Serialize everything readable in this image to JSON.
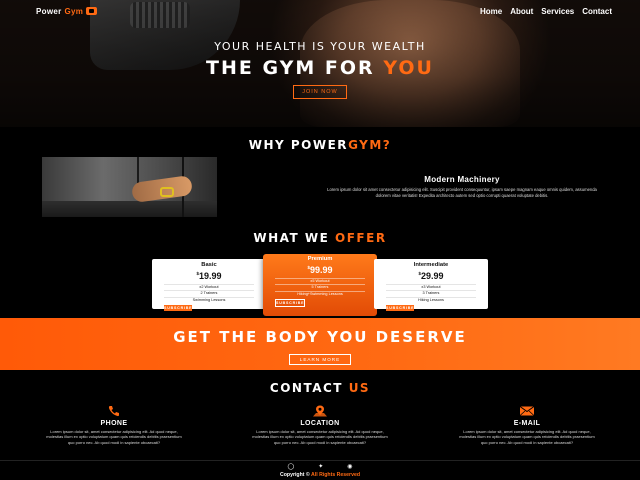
{
  "nav": {
    "logo_text": "Power",
    "logo_accent": "Gym",
    "links": [
      "Home",
      "About",
      "Services",
      "Contact"
    ]
  },
  "hero": {
    "subtitle": "YOUR HEALTH IS YOUR WEALTH",
    "title_main": "THE GYM FOR",
    "title_accent": "YOU",
    "button_label": "JOIN NOW"
  },
  "why": {
    "title_main": "WHY POWER",
    "title_accent": "GYM?",
    "feature_heading": "Modern Machinery",
    "feature_text": "Lorem ipsum dolor sit amet consectetur adipisicing elit. Suscipit provident consequuntur, ipsam saepe magnam eaque omnis quidem, assumenda dolorem vitae veritatis! Expedita architecto autem sed optio corrupti quaerat voluptate debitis."
  },
  "offer": {
    "title_main": "WHAT WE",
    "title_accent": "OFFER",
    "plans": [
      {
        "name": "Basic",
        "currency": "$",
        "price": "19.99",
        "features": [
          "x2 Workout",
          "2 Trainers",
          "Swimming Lessons"
        ],
        "button": "SUBSCRIBE"
      },
      {
        "name": "Premium",
        "currency": "$",
        "price": "99.99",
        "features": [
          "x5 Workout",
          "5 Trainers",
          "Hiking+Swimming Lessons"
        ],
        "button": "SUBSCRIBE"
      },
      {
        "name": "Intermediate",
        "currency": "$",
        "price": "29.99",
        "features": [
          "x3 Workout",
          "3 Trainers",
          "Hiking Lessons"
        ],
        "button": "SUBSCRIBE"
      }
    ]
  },
  "banner": {
    "title": "GET THE BODY YOU DESERVE",
    "button_label": "LEARN MORE"
  },
  "contact": {
    "title_main": "CONTACT",
    "title_accent": "US",
    "columns": [
      {
        "icon": "phone-icon",
        "heading": "PHONE",
        "text": "Lorem ipsum dolor sit, amet consectetur adipisicing elit. Ad quod neque, molestias illum ex optio voluptatum quam quis reiciendis debitis praesentium quo porro nec. Ab quod modi in sapiente obcaecati?"
      },
      {
        "icon": "location-icon",
        "heading": "LOCATION",
        "text": "Lorem ipsum dolor sit, amet consectetur adipisicing elit. Ad quod neque, molestias illum ex optio voluptatum quam quis reiciendis debitis praesentium quo porro nec. Ab quod modi in sapiente obcaecati?"
      },
      {
        "icon": "email-icon",
        "heading": "E-MAIL",
        "text": "Lorem ipsum dolor sit, amet consectetur adipisicing elit. Ad quod neque, molestias illum ex optio voluptatum quam quis reiciendis debitis praesentium quo porro nec. Ab quod modi in sapiente obcaecati?"
      }
    ]
  },
  "footer": {
    "social_icons": [
      "instagram-icon",
      "twitter-icon",
      "facebook-icon"
    ],
    "copyright_text": "Copyright ©",
    "copyright_accent": "All Rights Reserved"
  },
  "colors": {
    "accent": "#ff6a13",
    "background": "#000000"
  }
}
